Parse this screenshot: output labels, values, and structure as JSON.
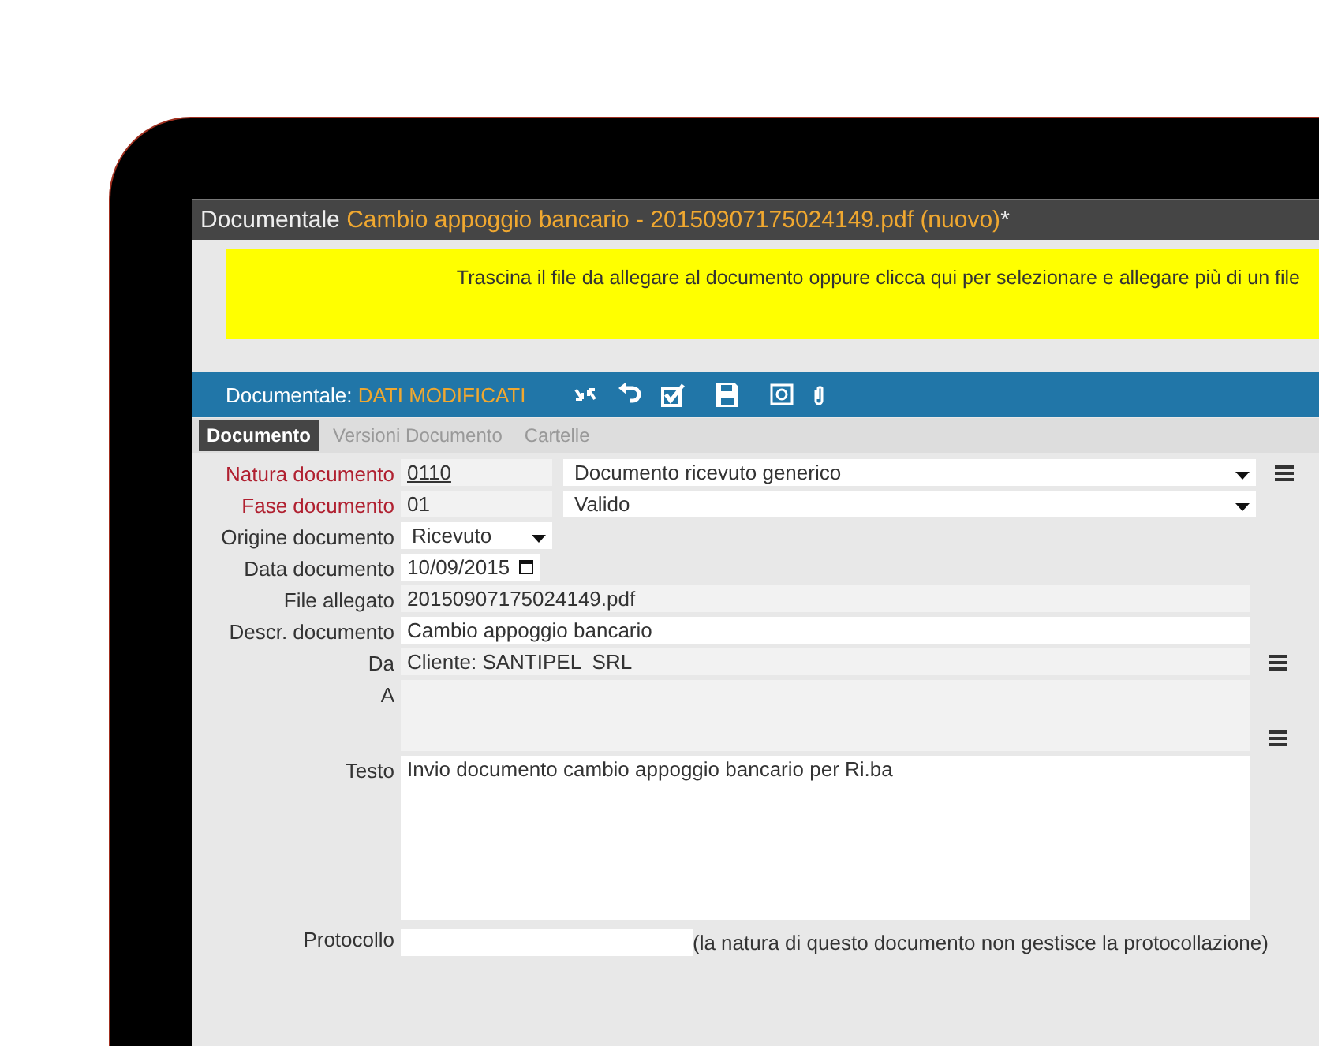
{
  "window": {
    "title": "Documentale",
    "document": "Cambio appoggio bancario - 20150907175024149.pdf (nuovo)",
    "modified_mark": "*"
  },
  "dropzone": {
    "text": "Trascina il file da allegare al documento oppure clicca qui per selezionare e allegare più di un file"
  },
  "toolbar": {
    "label": "Documentale:",
    "status": "DATI MODIFICATI"
  },
  "tabs": [
    {
      "label": "Documento",
      "selected": true
    },
    {
      "label": "Versioni Documento",
      "selected": false
    },
    {
      "label": "Cartelle",
      "selected": false
    }
  ],
  "fields": [
    {
      "kind": "code-select",
      "label": "Natura documento",
      "required": true,
      "code": "0110",
      "value": "Documento ricevuto generico",
      "menu": true
    },
    {
      "kind": "code-select",
      "label": "Fase documento",
      "required": true,
      "code": "01",
      "value": "Valido",
      "menu": false
    },
    {
      "kind": "select",
      "label": "Origine documento",
      "required": false,
      "value": "Ricevuto"
    },
    {
      "kind": "date",
      "label": "Data documento",
      "required": false,
      "value": "10/09/2015"
    },
    {
      "kind": "readonly",
      "label": "File allegato",
      "required": false,
      "value": "20150907175024149.pdf",
      "menu": false
    },
    {
      "kind": "text",
      "label": "Descr. documento",
      "required": false,
      "value": "Cambio appoggio bancario"
    },
    {
      "kind": "readonly",
      "label": "Da",
      "required": false,
      "value": "Cliente: SANTIPEL  SRL",
      "menu": true
    },
    {
      "kind": "multi",
      "label": "A",
      "required": false,
      "menu": true
    },
    {
      "kind": "textarea",
      "label": "Testo",
      "required": false,
      "value": "Invio documento cambio appoggio bancario per Ri.ba"
    },
    {
      "kind": "protocol",
      "label": "Protocollo",
      "required": false,
      "note": "(la natura di questo documento non gestisce la protocollazione)"
    }
  ]
}
